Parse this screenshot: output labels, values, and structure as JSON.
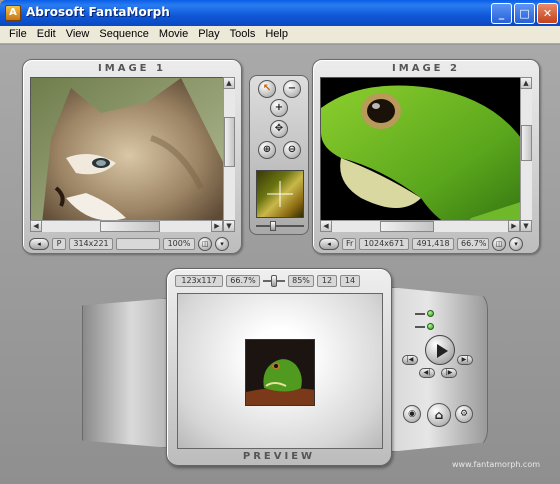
{
  "window": {
    "title": "Abrosoft FantaMorph",
    "buttons": {
      "minimize": "_",
      "maximize": "□",
      "close": "✕"
    }
  },
  "menu": [
    "File",
    "Edit",
    "View",
    "Sequence",
    "Movie",
    "Play",
    "Tools",
    "Help"
  ],
  "image1": {
    "title": "IMAGE 1",
    "status": {
      "mode": "P",
      "size": "314x221",
      "blank": "",
      "zoom": "100%"
    }
  },
  "image2": {
    "title": "IMAGE 2",
    "status": {
      "mode": "Fr",
      "size": "1024x671",
      "coords": "491,418",
      "zoom": "66.7%"
    }
  },
  "preview": {
    "title": "PREVIEW",
    "toolbar": {
      "size": "123x117",
      "zoom": "66.7%",
      "percent": "85%",
      "frame": "12",
      "total": "14"
    }
  },
  "website": "www.fantamorph.com",
  "icons": {
    "select": "pointer-icon",
    "minus": "minus-icon",
    "plus": "plus-icon",
    "point": "move-point-icon",
    "zoom_in": "zoom-in-icon",
    "zoom_out": "zoom-out-icon",
    "play": "play-icon",
    "camera": "snapshot-icon",
    "settings": "gear-icon"
  },
  "colors": {
    "accent": "#0a5ee8",
    "led": "#1e9a1e"
  }
}
